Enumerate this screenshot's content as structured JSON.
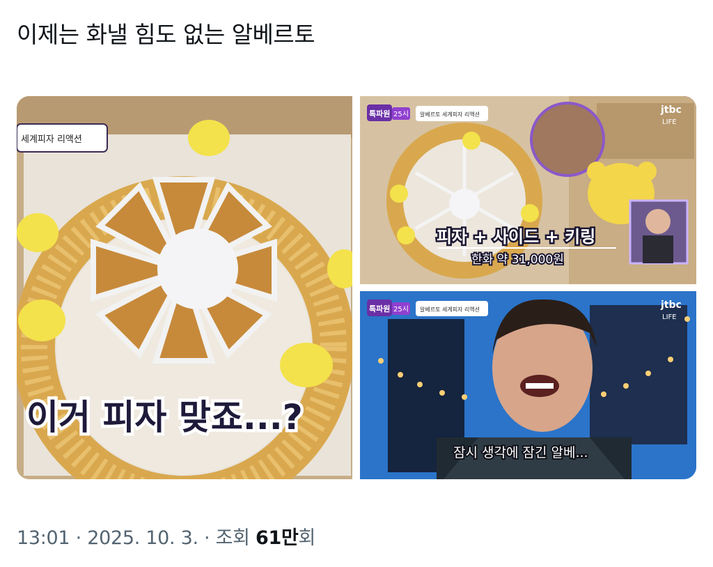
{
  "tweet": {
    "text": "이제는 화낼 힘도 없는 알베르토"
  },
  "media": {
    "main": {
      "tag": "세계피자 리액션",
      "caption": "이거 피자 맞죠...?"
    },
    "top_right": {
      "badge": "톡파원",
      "badge_sub": "25시",
      "tag": "알베르토 세계피자 리액션",
      "channel": "jtbc",
      "channel_sub": "LIFE",
      "caption": "피자 + 사이드 + 키링",
      "price": "한화 약 31,000원"
    },
    "bottom_right": {
      "badge": "톡파원",
      "badge_sub": "25시",
      "tag": "알베르토 세계피자 리액션",
      "channel": "jtbc",
      "channel_sub": "LIFE",
      "caption": "잠시 생각에 잠긴 알베..."
    }
  },
  "footer": {
    "time": "13:01",
    "date": "2025. 10. 3.",
    "views_label": "조회",
    "views_count": "61만",
    "views_suffix": "회"
  }
}
